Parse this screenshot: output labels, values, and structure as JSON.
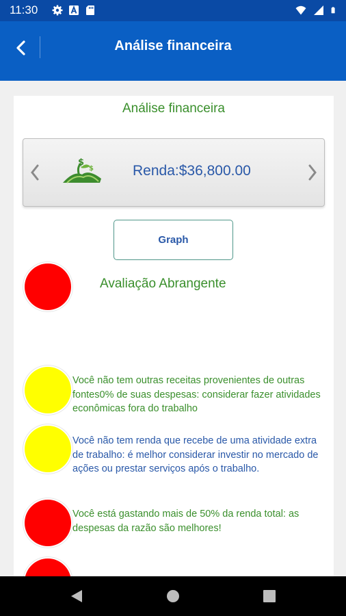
{
  "status_bar": {
    "time": "11:30",
    "left_icons": [
      "gear-icon",
      "a-box-icon",
      "sd-card-icon"
    ],
    "right_icons": [
      "wifi-icon",
      "signal-icon",
      "battery-icon"
    ]
  },
  "app_bar": {
    "title": "Análise financeira",
    "back_icon": "chevron-left-icon"
  },
  "card": {
    "title": "Análise financeira",
    "income": {
      "label": "Renda:$36,800.00",
      "icon": "money-plant-icon"
    },
    "graph_button": "Graph",
    "overall": {
      "title": "Avaliação Abrangente",
      "status": "red"
    },
    "items": [
      {
        "status": "yellow",
        "color": "green",
        "text": "Você não tem outras receitas provenientes de outras fontes0% de suas despesas: considerar fazer atividades econômicas fora do trabalho"
      },
      {
        "status": "yellow",
        "color": "blue",
        "text": "Você não tem renda que recebe de uma atividade extra de trabalho: é melhor considerar investir no mercado de ações ou prestar serviços após o trabalho."
      },
      {
        "status": "red",
        "color": "green",
        "text": "Você está gastando mais de 50% da renda total: as despesas da razão são melhores!"
      }
    ]
  },
  "colors": {
    "status_bar": "#0a4aa5",
    "app_bar": "#0a5fc4",
    "accent_green": "#3a8f2c",
    "accent_blue": "#2958a8",
    "red": "#ff0000",
    "yellow": "#ffff00"
  },
  "nav_bar": {
    "buttons": [
      "back-triangle-icon",
      "home-circle-icon",
      "recents-square-icon"
    ]
  }
}
